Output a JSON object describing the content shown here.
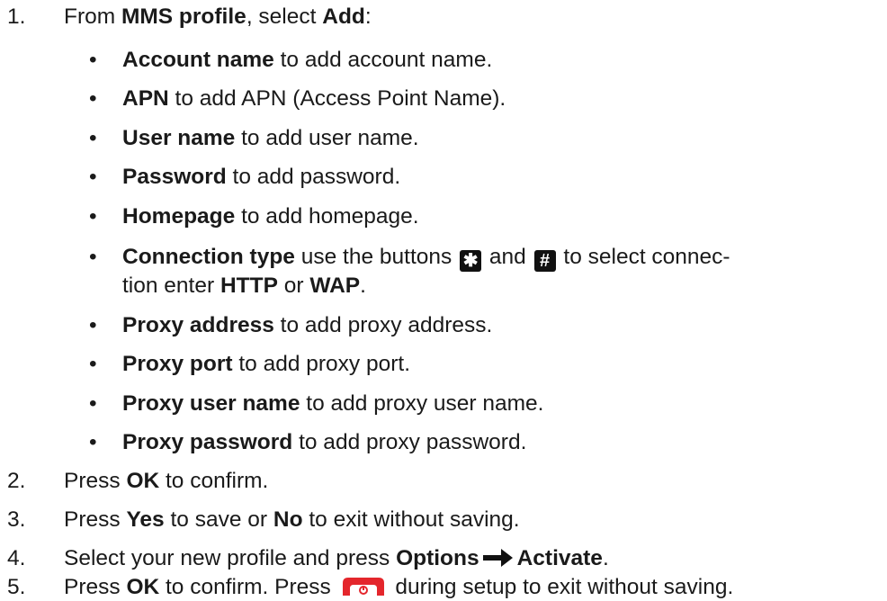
{
  "steps": [
    {
      "number": "1.",
      "text_before": "From ",
      "bold1": "MMS profile",
      "text_mid": ", select ",
      "bold2": "Add",
      "text_after": ":"
    },
    {
      "number": "2.",
      "text_before": "Press ",
      "bold": "OK",
      "text_after": " to confirm."
    },
    {
      "number": "3.",
      "text_before": "Press ",
      "bold1": "Yes",
      "text_mid": " to save or ",
      "bold2": "No",
      "text_after": " to exit without saving."
    },
    {
      "number": "4.",
      "text_before": "Select your new profile and press ",
      "bold1": "Options",
      "bold2": "Activate",
      "text_after": "."
    },
    {
      "number": "5.",
      "text_before": "Press ",
      "bold": "OK",
      "text_mid": " to confirm. Press ",
      "text_after": " during setup to exit without saving."
    }
  ],
  "bullet_char": "•",
  "sub_items": [
    {
      "bold": "Account name",
      "text": " to add account name."
    },
    {
      "bold": "APN",
      "text": " to add APN (Access Point Name)."
    },
    {
      "bold": "User name",
      "text": " to add user name."
    },
    {
      "bold": "Password",
      "text": " to add password."
    },
    {
      "bold": "Homepage",
      "text": " to add homepage."
    },
    {
      "bold": "Connection type",
      "text1": " use the buttons ",
      "key1": "✱",
      "text2": " and ",
      "key2": "#",
      "text3": " to select connec-",
      "line2_text": "tion enter ",
      "bold2": "HTTP",
      "line2_mid": " or ",
      "bold3": "WAP",
      "line2_end": "."
    },
    {
      "bold": "Proxy address",
      "text": " to add proxy address."
    },
    {
      "bold": "Proxy port",
      "text": " to add proxy port."
    },
    {
      "bold": "Proxy user name",
      "text": " to add proxy user name."
    },
    {
      "bold": "Proxy password",
      "text": " to add proxy password."
    }
  ],
  "icons": {
    "arrow": "right-arrow-icon",
    "end_key": "end-call-key-icon",
    "end_key_color": "#e4262c"
  }
}
